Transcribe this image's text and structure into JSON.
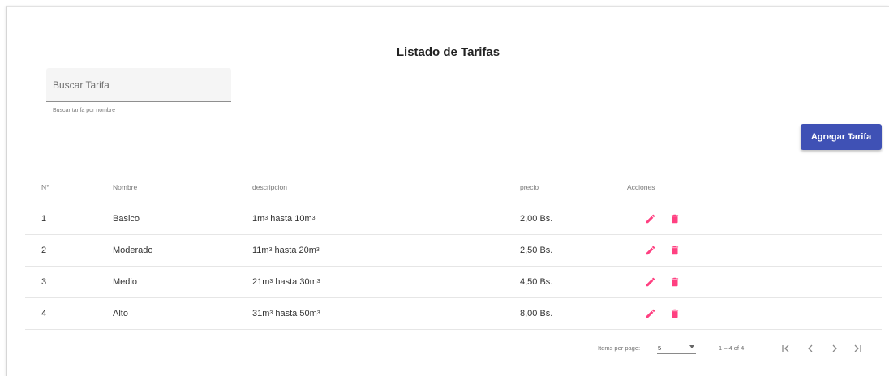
{
  "title": "Listado de Tarifas",
  "search": {
    "placeholder": "Buscar Tarifa",
    "hint": "Buscar tarifa por nombre"
  },
  "add_button_label": "Agregar Tarifa",
  "table": {
    "headers": [
      "N°",
      "Nombre",
      "descripcion",
      "precio",
      "Acciones"
    ],
    "rows": [
      {
        "num": "1",
        "name": "Basico",
        "desc_from": "1m",
        "desc_mid": " hasta 10m",
        "exp": "3",
        "price": "2,00 Bs."
      },
      {
        "num": "2",
        "name": "Moderado",
        "desc_from": "11m",
        "desc_mid": " hasta 20m",
        "exp": "3",
        "price": "2,50 Bs."
      },
      {
        "num": "3",
        "name": "Medio",
        "desc_from": "21m",
        "desc_mid": " hasta 30m",
        "exp": "3",
        "price": "4,50 Bs."
      },
      {
        "num": "4",
        "name": "Alto",
        "desc_from": "31m",
        "desc_mid": " hasta 50m",
        "exp": "3",
        "price": "8,00 Bs."
      }
    ]
  },
  "paginator": {
    "items_per_page_label": "Items per page:",
    "page_size": "5",
    "range_label": "1 – 4 of 4"
  },
  "colors": {
    "primary": "#3f51b5",
    "accent": "#ff4081"
  },
  "icons": {
    "edit": "pencil-icon",
    "delete": "trash-icon",
    "first": "first-page-icon",
    "prev": "chevron-left-icon",
    "next": "chevron-right-icon",
    "last": "last-page-icon"
  }
}
